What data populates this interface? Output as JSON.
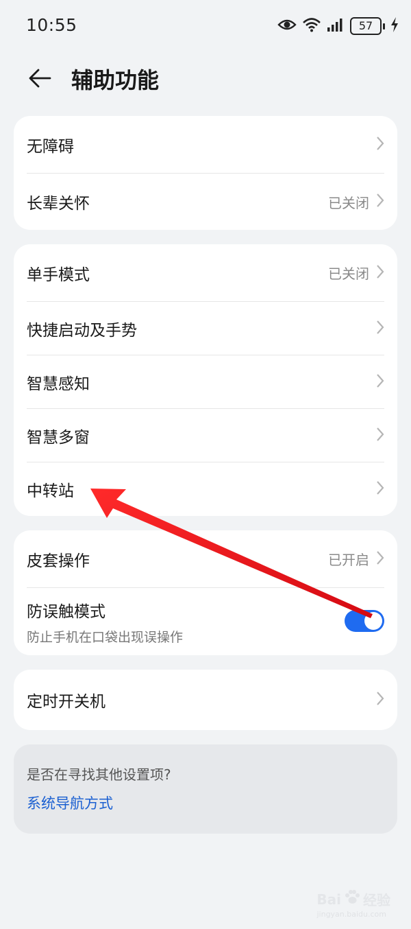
{
  "status_bar": {
    "time": "10:55",
    "battery": "57",
    "icons": [
      "eye-icon",
      "wifi-icon",
      "signal-icon",
      "battery-icon",
      "charging-bolt-icon"
    ]
  },
  "header": {
    "title": "辅助功能",
    "back_icon": "back-arrow-icon"
  },
  "groups": {
    "g1": [
      {
        "label": "无障碍",
        "value": ""
      },
      {
        "label": "长辈关怀",
        "value": "已关闭"
      }
    ],
    "g2": [
      {
        "label": "单手模式",
        "value": "已关闭"
      },
      {
        "label": "快捷启动及手势",
        "value": ""
      },
      {
        "label": "智慧感知",
        "value": ""
      },
      {
        "label": "智慧多窗",
        "value": ""
      },
      {
        "label": "中转站",
        "value": ""
      }
    ],
    "g3": {
      "case": {
        "label": "皮套操作",
        "value": "已开启"
      },
      "pocket": {
        "label": "防误触模式",
        "subtitle": "防止手机在口袋出现误操作",
        "toggle_on": true
      }
    },
    "g4": [
      {
        "label": "定时开关机",
        "value": ""
      }
    ]
  },
  "suggestion": {
    "question": "是否在寻找其他设置项?",
    "link": "系统导航方式"
  },
  "watermark": {
    "brand": "Bai",
    "suffix": "经验",
    "url": "jingyan.baidu.com"
  },
  "colors": {
    "accent": "#1f6bf0",
    "link": "#1a5fd1",
    "annotation_arrow": "#e8141a",
    "background": "#f1f3f5"
  }
}
